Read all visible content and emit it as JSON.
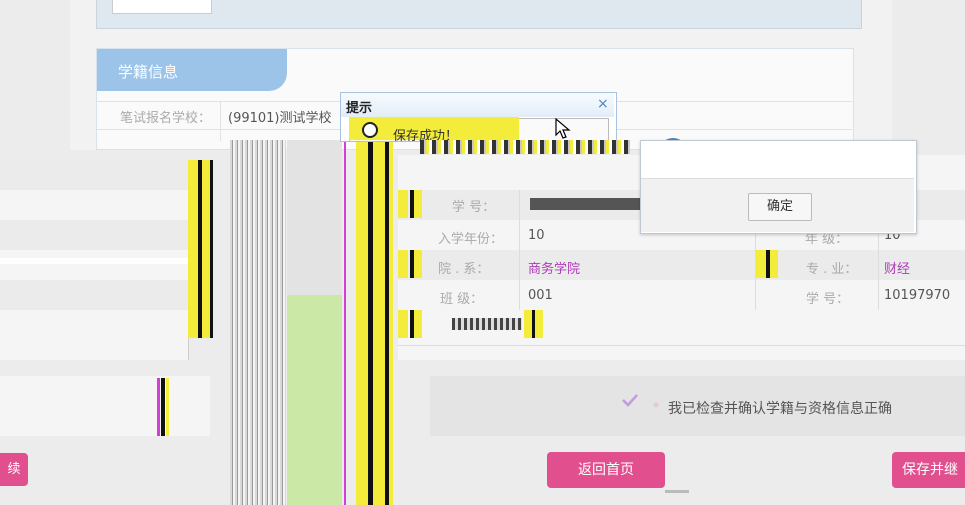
{
  "top_section": {
    "tab_title": "学籍信息",
    "rows": [
      {
        "label": "笔试报名学校：",
        "value": "(99101)测试学校"
      }
    ]
  },
  "dialog": {
    "title": "提示",
    "close_label": "×",
    "message": "保存成功！",
    "ok_label": "确定"
  },
  "fields": {
    "name_label": "学 号：",
    "year_label": "入学年份：",
    "year_value": "10",
    "dept_label": "院 . 系：",
    "dept_value": "商务学院",
    "class_label": "班 级：",
    "class_value": "001",
    "grade_label": "年 级：",
    "grade_value": "10",
    "major_label": "专 . 业：",
    "major_value": "财经",
    "stuno_label": "学 号：",
    "stuno_value": "10197970"
  },
  "confirm": {
    "check_icon": "check-icon",
    "required_mark": "*",
    "text": "我已检查并确认学籍与资格信息正确"
  },
  "buttons": {
    "left_partial": "续",
    "back_home": "返回首页",
    "save_continue": "保存并继"
  },
  "colors": {
    "tab_blue": "#9cc3e8",
    "pink_button": "#e24f8f",
    "check_purple": "#c39be0",
    "glitch_yellow": "#f4ec3a"
  }
}
